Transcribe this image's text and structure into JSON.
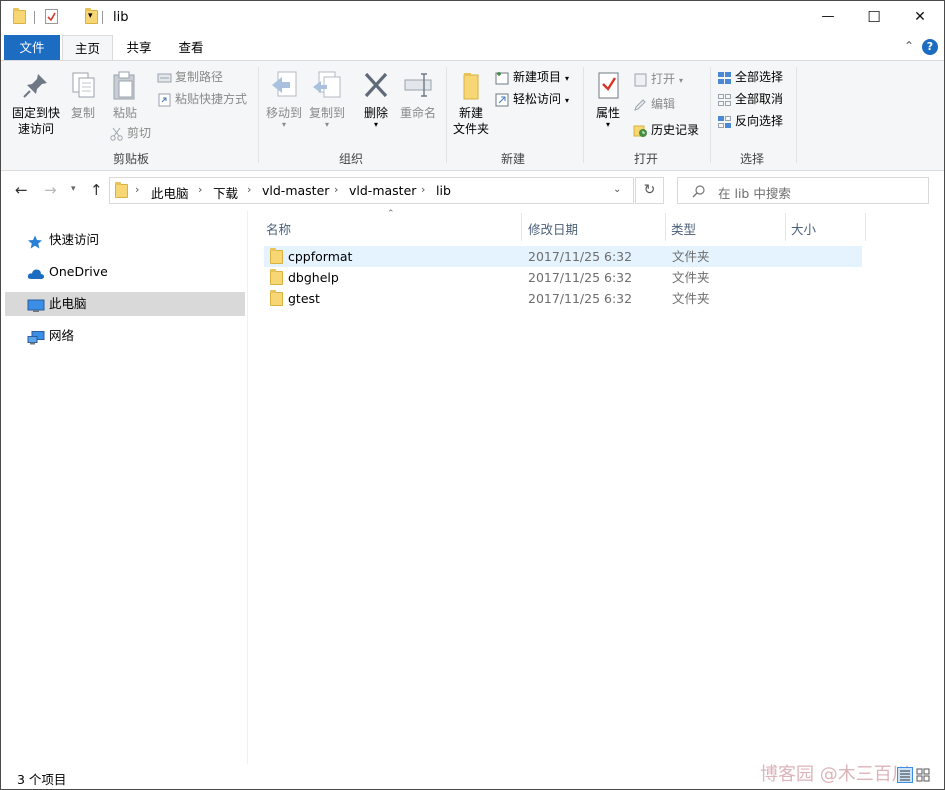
{
  "window": {
    "title": "lib",
    "controls": {
      "minimize": "—",
      "maximize": "☐",
      "close": "✕"
    }
  },
  "ribbon_tabs": [
    "文件",
    "主页",
    "共享",
    "查看"
  ],
  "ribbon": {
    "groups": {
      "clipboard": "剪贴板",
      "organize": "组织",
      "new": "新建",
      "open": "打开",
      "select": "选择"
    },
    "pin": {
      "line1": "固定到快",
      "line2": "速访问"
    },
    "copy": "复制",
    "paste": "粘贴",
    "copy_path": "复制路径",
    "paste_shortcut": "粘贴快捷方式",
    "cut": "剪切",
    "move_to": "移动到",
    "copy_to": "复制到",
    "delete": "删除",
    "rename": "重命名",
    "new_folder": {
      "line1": "新建",
      "line2": "文件夹"
    },
    "new_item": "新建项目",
    "easy_access": "轻松访问",
    "properties": "属性",
    "open": "打开",
    "edit": "编辑",
    "history": "历史记录",
    "select_all": "全部选择",
    "select_none": "全部取消",
    "invert_selection": "反向选择"
  },
  "breadcrumb": [
    "此电脑",
    "下载",
    "vld-master",
    "vld-master",
    "lib"
  ],
  "search": {
    "placeholder": "在 lib 中搜索"
  },
  "nav_pane": [
    {
      "label": "快速访问",
      "icon": "star-icon",
      "selected": false
    },
    {
      "label": "OneDrive",
      "icon": "cloud-icon",
      "selected": false
    },
    {
      "label": "此电脑",
      "icon": "computer-icon",
      "selected": true
    },
    {
      "label": "网络",
      "icon": "network-icon",
      "selected": false
    }
  ],
  "columns": {
    "name": "名称",
    "date": "修改日期",
    "type": "类型",
    "size": "大小"
  },
  "files": [
    {
      "name": "cppformat",
      "date": "2017/11/25 6:32",
      "type": "文件夹"
    },
    {
      "name": "dbghelp",
      "date": "2017/11/25 6:32",
      "type": "文件夹"
    },
    {
      "name": "gtest",
      "date": "2017/11/25 6:32",
      "type": "文件夹"
    }
  ],
  "status": {
    "item_count": "3 个项目"
  },
  "watermark": "博客园 @木三百川",
  "colors": {
    "accent": "#1c6cc1",
    "selected_row": "#e5f3ff",
    "nav_selected": "#d9d9d9",
    "folder": "#f7d774"
  }
}
